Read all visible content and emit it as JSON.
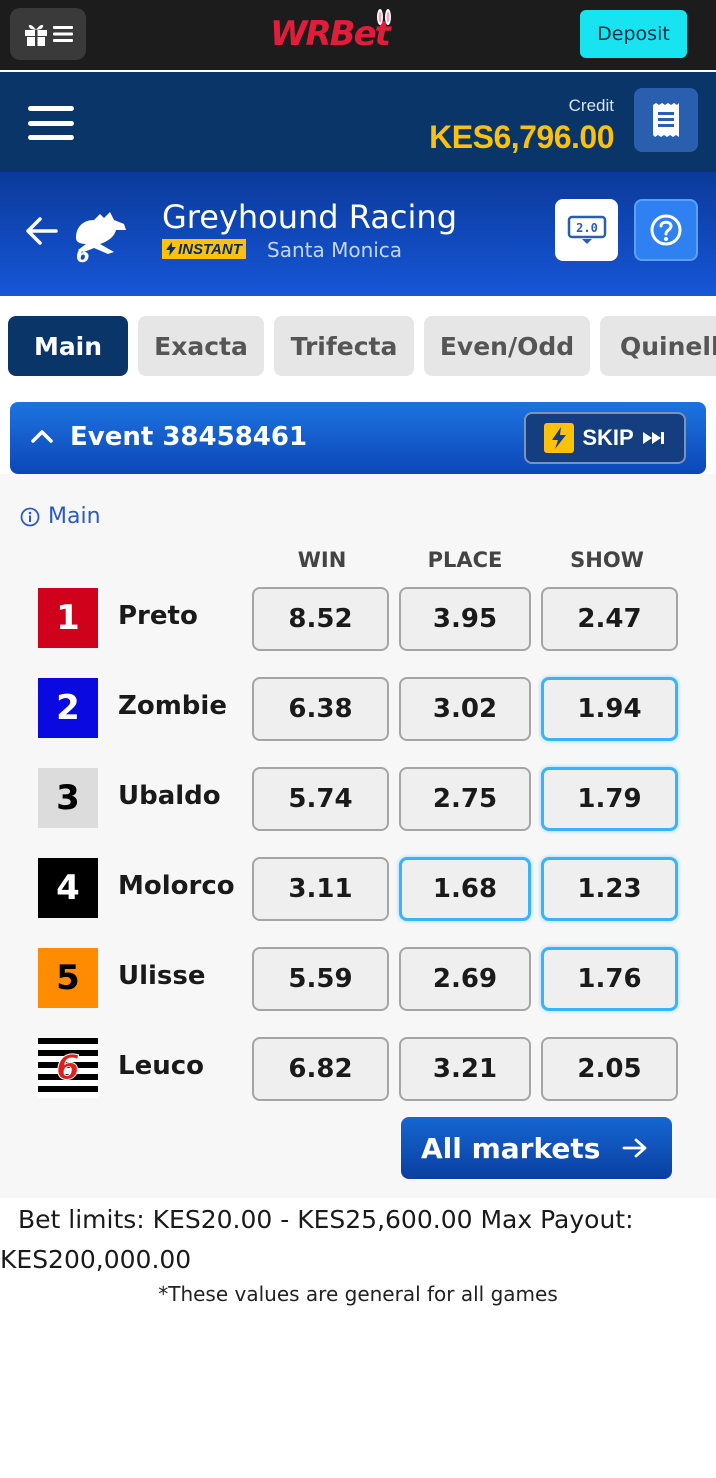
{
  "topbar": {
    "logo_text": "WRBet",
    "deposit_label": "Deposit"
  },
  "account": {
    "credit_label": "Credit",
    "credit_value": "KES6,796.00"
  },
  "game": {
    "title": "Greyhound Racing",
    "badge": "INSTANT",
    "venue": "Santa Monica",
    "stats_label": "2.0"
  },
  "tabs": [
    {
      "label": "Main",
      "active": true
    },
    {
      "label": "Exacta",
      "active": false
    },
    {
      "label": "Trifecta",
      "active": false
    },
    {
      "label": "Even/Odd",
      "active": false
    },
    {
      "label": "Quinella",
      "active": false
    }
  ],
  "event": {
    "title": "Event 38458461",
    "skip_label": "SKIP"
  },
  "market": {
    "label": "Main",
    "columns": [
      "WIN",
      "PLACE",
      "SHOW"
    ],
    "runners": [
      {
        "trap": "1",
        "name": "Preto",
        "trap_color": "#d0021b",
        "win": "8.52",
        "place": "3.95",
        "show": "2.47",
        "highlight": []
      },
      {
        "trap": "2",
        "name": "Zombie",
        "trap_color": "#0a0ae0",
        "win": "6.38",
        "place": "3.02",
        "show": "1.94",
        "highlight": [
          "show"
        ]
      },
      {
        "trap": "3",
        "name": "Ubaldo",
        "trap_color": "#dcdcdc",
        "win": "5.74",
        "place": "2.75",
        "show": "1.79",
        "highlight": [
          "show"
        ]
      },
      {
        "trap": "4",
        "name": "Molorco",
        "trap_color": "#000000",
        "win": "3.11",
        "place": "1.68",
        "show": "1.23",
        "highlight": [
          "place",
          "show"
        ]
      },
      {
        "trap": "5",
        "name": "Ulisse",
        "trap_color": "#ff8c00",
        "win": "5.59",
        "place": "2.69",
        "show": "1.76",
        "highlight": [
          "show"
        ]
      },
      {
        "trap": "6",
        "name": "Leuco",
        "trap_color": "striped",
        "win": "6.82",
        "place": "3.21",
        "show": "2.05",
        "highlight": []
      }
    ],
    "all_markets_label": "All markets"
  },
  "limits": {
    "line1": "Bet limits: KES20.00 - KES25,600.00    Max Payout:",
    "line2": "KES200,000.00",
    "note": "*These values are general for all games"
  },
  "colors": {
    "brand_dark": "#0a3568",
    "accent_cyan": "#17e4f0",
    "credit_gold": "#fcc10c",
    "odds_highlight": "#39b4f8"
  }
}
